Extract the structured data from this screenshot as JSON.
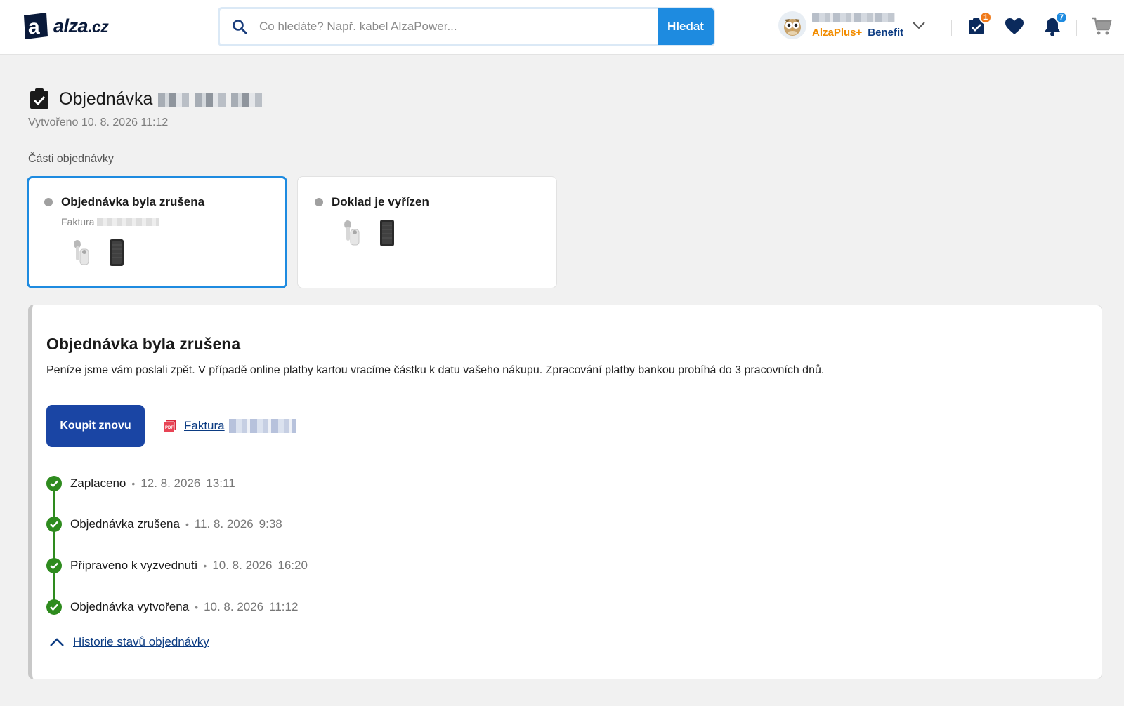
{
  "header": {
    "logo": {
      "text": "alza",
      "tld": ".cz"
    },
    "search": {
      "placeholder": "Co hledáte? Např. kabel AlzaPower...",
      "button_label": "Hledat"
    },
    "user": {
      "plus_label": "AlzaPlus+",
      "benefit_label": "Benefit"
    },
    "badges": {
      "orders": "1",
      "notifications": "7"
    }
  },
  "order": {
    "title": "Objednávka",
    "created": "Vytvořeno 10. 8. 2026 11:12",
    "parts_label": "Části objednávky"
  },
  "parts": [
    {
      "status": "Objednávka byla zrušena",
      "sub": "Faktura"
    },
    {
      "status": "Doklad je vyřízen"
    }
  ],
  "detail": {
    "title": "Objednávka byla zrušena",
    "description": "Peníze jsme vám poslali zpět. V případě online platby kartou vracíme částku k datu vašeho nákupu. Zpracování platby bankou probíhá do 3 pracovních dnů.",
    "buy_again": "Koupit znovu",
    "invoice_link": "Faktura",
    "timeline": [
      {
        "label": "Zaplaceno",
        "date": "12. 8. 2026",
        "time": "13:11"
      },
      {
        "label": "Objednávka zrušena",
        "date": "11. 8. 2026",
        "time": "9:38"
      },
      {
        "label": "Připraveno k vyzvednutí",
        "date": "10. 8. 2026",
        "time": "16:20"
      },
      {
        "label": "Objednávka vytvořena",
        "date": "10. 8. 2026",
        "time": "11:12"
      }
    ],
    "history_link": "Historie stavů objednávky"
  },
  "colors": {
    "accent": "#1e8be0",
    "primary_button": "#1a45a4",
    "success": "#2e8b1e",
    "plus": "#f28c00",
    "link": "#0b3b82"
  }
}
